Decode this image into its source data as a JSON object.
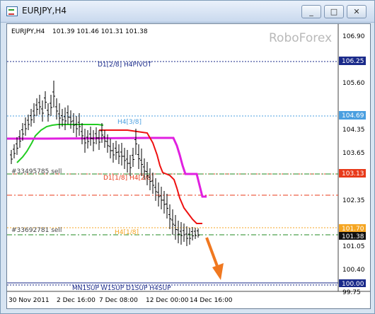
{
  "window": {
    "title": "EURJPY,H4",
    "minimize_label": "_",
    "restore_label": "□",
    "close_label": "✕"
  },
  "chart_header": {
    "symbol": "EURJPY,H4",
    "ohlc": "101.39 101.46 101.31 101.38",
    "watermark": "RoboForex"
  },
  "y_axis": {
    "ticks": [
      "106.90",
      "105.60",
      "104.35",
      "103.65",
      "102.35",
      "101.05",
      "100.40",
      "99.75"
    ],
    "highlights": [
      {
        "label": "106.25",
        "bg": "#1a2a8a",
        "fg": "#ffffff"
      },
      {
        "label": "104.69",
        "bg": "#4a9fe0",
        "fg": "#ffffff"
      },
      {
        "label": "103.13",
        "bg": "#e83a1a",
        "fg": "#ffffff"
      },
      {
        "label": "101.70",
        "bg": "#f5a623",
        "fg": "#ffffff"
      },
      {
        "label": "101.38",
        "bg": "#111111",
        "fg": "#ffffff"
      },
      {
        "label": "100.00",
        "bg": "#1a2a8a",
        "fg": "#ffffff"
      }
    ]
  },
  "x_axis": {
    "ticks": [
      "30 Nov 2011",
      "2 Dec 16:00",
      "7 Dec 08:00",
      "12 Dec 00:00",
      "14 Dec 16:00"
    ]
  },
  "levels": {
    "pivot": {
      "label": "D1[2/8] H4PIVOT",
      "color": "#1a2a8a"
    },
    "h4_38": {
      "label": "H4[3/8]",
      "color": "#4a9fe0"
    },
    "sell1": {
      "label": "#33495785 sell",
      "color": "#444444"
    },
    "d1_h4": {
      "label": "D1[1/8] H4[2/8]",
      "color": "#e83a1a"
    },
    "sell2": {
      "label": "#33692781 sell",
      "color": "#444444"
    },
    "h4_18": {
      "label": "H4[1/8]",
      "color": "#f5a623"
    },
    "support": {
      "label": "MN1SUP W1SUP D1SUP H4SUP",
      "color": "#1a2a8a"
    }
  },
  "colors": {
    "magenta": "#e020e0",
    "red": "#ee1111",
    "green": "#22cc22",
    "arrow": "#f07820",
    "dash_green": "#228822"
  }
}
